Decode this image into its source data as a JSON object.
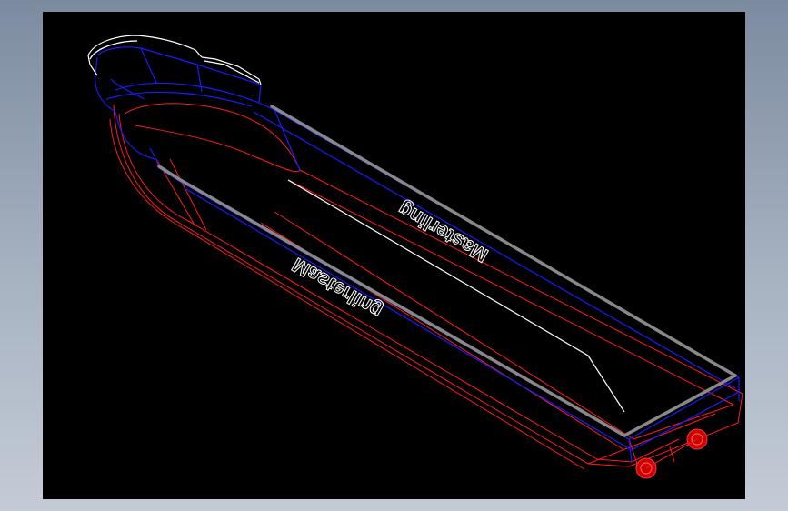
{
  "model": {
    "labels": {
      "starboard": "Masterling",
      "port": "Masterling"
    }
  },
  "colors": {
    "background_outer": "#8f9db0",
    "viewport": "#000000",
    "deck_edge": "#888888",
    "hull_blue": "#1a1aff",
    "hull_red": "#ff1a1a",
    "white_line": "#ffffff",
    "wheel": "#c00000"
  }
}
